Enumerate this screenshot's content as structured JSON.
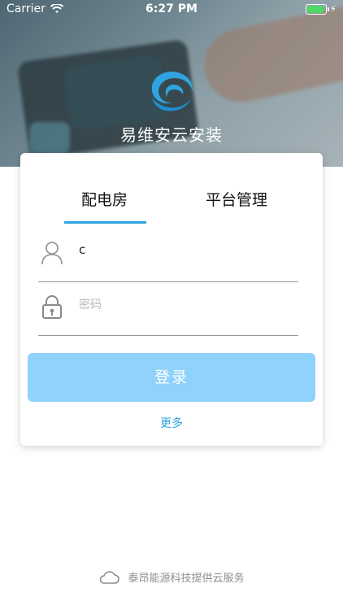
{
  "status_bar": {
    "carrier": "Carrier",
    "time": "6:27 PM",
    "battery_level": 1.0
  },
  "brand": {
    "app_name": "易维安云安装",
    "logo_icon": "swirl-logo-icon",
    "accent_color": "#2fa4e0"
  },
  "tabs": [
    {
      "label": "配电房",
      "selected": true
    },
    {
      "label": "平台管理",
      "selected": false
    }
  ],
  "form": {
    "username": {
      "icon": "user-icon",
      "value": "c"
    },
    "password": {
      "icon": "lock-icon",
      "placeholder": "密码",
      "value": ""
    },
    "login_label": "登录",
    "login_color": "#8fd2fb",
    "more_label": "更多"
  },
  "footer": {
    "icon": "cloud-icon",
    "text": "泰昂能源科技提供云服务"
  }
}
